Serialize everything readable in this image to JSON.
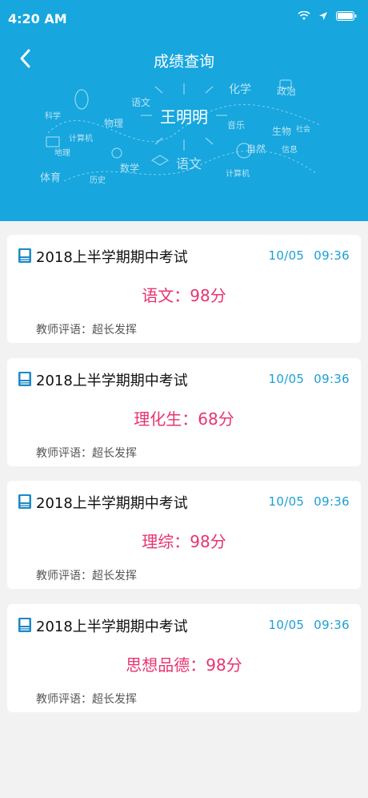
{
  "status_bar": {
    "time": "4:20 AM"
  },
  "nav": {
    "title": "成绩查询"
  },
  "student": {
    "name": "王明明"
  },
  "doodle_words": [
    "语文",
    "化学",
    "政治",
    "物理",
    "科学",
    "地理",
    "音乐",
    "生物",
    "计算机",
    "社会",
    "信息",
    "自然",
    "数学",
    "体育",
    "历史",
    "计算机",
    "语文"
  ],
  "colors": {
    "header_bg": "#17a6de",
    "score": "#e8346f",
    "date": "#1c9fd6"
  },
  "records": [
    {
      "exam": "2018上半学期期中考试",
      "date": "10/05",
      "time": "09:36",
      "score": "语文：98分",
      "comment": "教师评语：超长发挥"
    },
    {
      "exam": "2018上半学期期中考试",
      "date": "10/05",
      "time": "09:36",
      "score": "理化生：68分",
      "comment": "教师评语：超长发挥"
    },
    {
      "exam": "2018上半学期期中考试",
      "date": "10/05",
      "time": "09:36",
      "score": "理综：98分",
      "comment": "教师评语：超长发挥"
    },
    {
      "exam": "2018上半学期期中考试",
      "date": "10/05",
      "time": "09:36",
      "score": "思想品德：98分",
      "comment": "教师评语：超长发挥"
    }
  ]
}
